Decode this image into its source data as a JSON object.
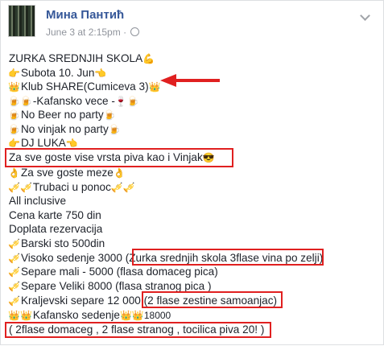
{
  "post": {
    "author": "Мина Пантић",
    "timestamp": "June 3 at 2:15pm",
    "separator": "·",
    "lines": [
      {
        "emoji_before": "",
        "text": "ZURKA SREDNJIH SKOLA",
        "emoji_after": "💪"
      },
      {
        "emoji_before": "👉",
        "text": "Subota 10. Jun",
        "emoji_after": "👈"
      },
      {
        "emoji_before": "👑",
        "text": "Klub SHARE(Cumiceva 3)",
        "emoji_after": "👑"
      },
      {
        "emoji_before": "🍺🍺",
        "text": "-Kafansko vece -",
        "emoji_after": "🍷🍺"
      },
      {
        "emoji_before": "🍺",
        "text": "No Beer no party",
        "emoji_after": "🍺"
      },
      {
        "emoji_before": "🍺",
        "text": "No vinjak no party",
        "emoji_after": "🍺"
      },
      {
        "emoji_before": "👉",
        "text": "DJ LUKA",
        "emoji_after": "👈"
      },
      {
        "emoji_before": "",
        "text": "Za sve goste vise vrsta piva kao i Vinjak",
        "emoji_after": "😎"
      },
      {
        "emoji_before": "👌",
        "text": "Za sve goste meze",
        "emoji_after": "👌"
      },
      {
        "emoji_before": "🎺🎺",
        "text": "Trubaci u ponoc",
        "emoji_after": "🎺🎺"
      },
      {
        "emoji_before": "",
        "text": "All inclusive",
        "emoji_after": ""
      },
      {
        "emoji_before": "",
        "text": "Cena karte 750 din",
        "emoji_after": ""
      },
      {
        "emoji_before": "",
        "text": "Doplata rezervacija",
        "emoji_after": ""
      },
      {
        "emoji_before": "🎺",
        "text": "Barski sto 500din",
        "emoji_after": ""
      },
      {
        "emoji_before": "🎺",
        "text": "Visoko sedenje 3000 (Zurka srednjih skola 3flase vina po zelji)",
        "emoji_after": ""
      },
      {
        "emoji_before": "🎺",
        "text": "Separe mali - 5000 (flasa domaceg pica)",
        "emoji_after": ""
      },
      {
        "emoji_before": "🎺",
        "text": "Separe Veliki 8000 (flasa stranog pica )",
        "emoji_after": ""
      },
      {
        "emoji_before": "🎺",
        "text": "Kraljevski separe 12 000 (2 flase zestine samoanjac)",
        "emoji_after": ""
      },
      {
        "emoji_before": "👑👑",
        "text": "Kafansko sedenje",
        "emoji_after": "👑👑18000"
      },
      {
        "emoji_before": "",
        "text": "( 2flase domaceg , 2 flase stranog , tocilica piva 20! )",
        "emoji_after": ""
      }
    ]
  },
  "icons": {
    "globe": "globe-icon",
    "menu": "chevron-down-icon",
    "arrow": "red-arrow-left-icon"
  },
  "colors": {
    "author": "#365899",
    "meta": "#90949c",
    "highlight": "#e02020"
  }
}
